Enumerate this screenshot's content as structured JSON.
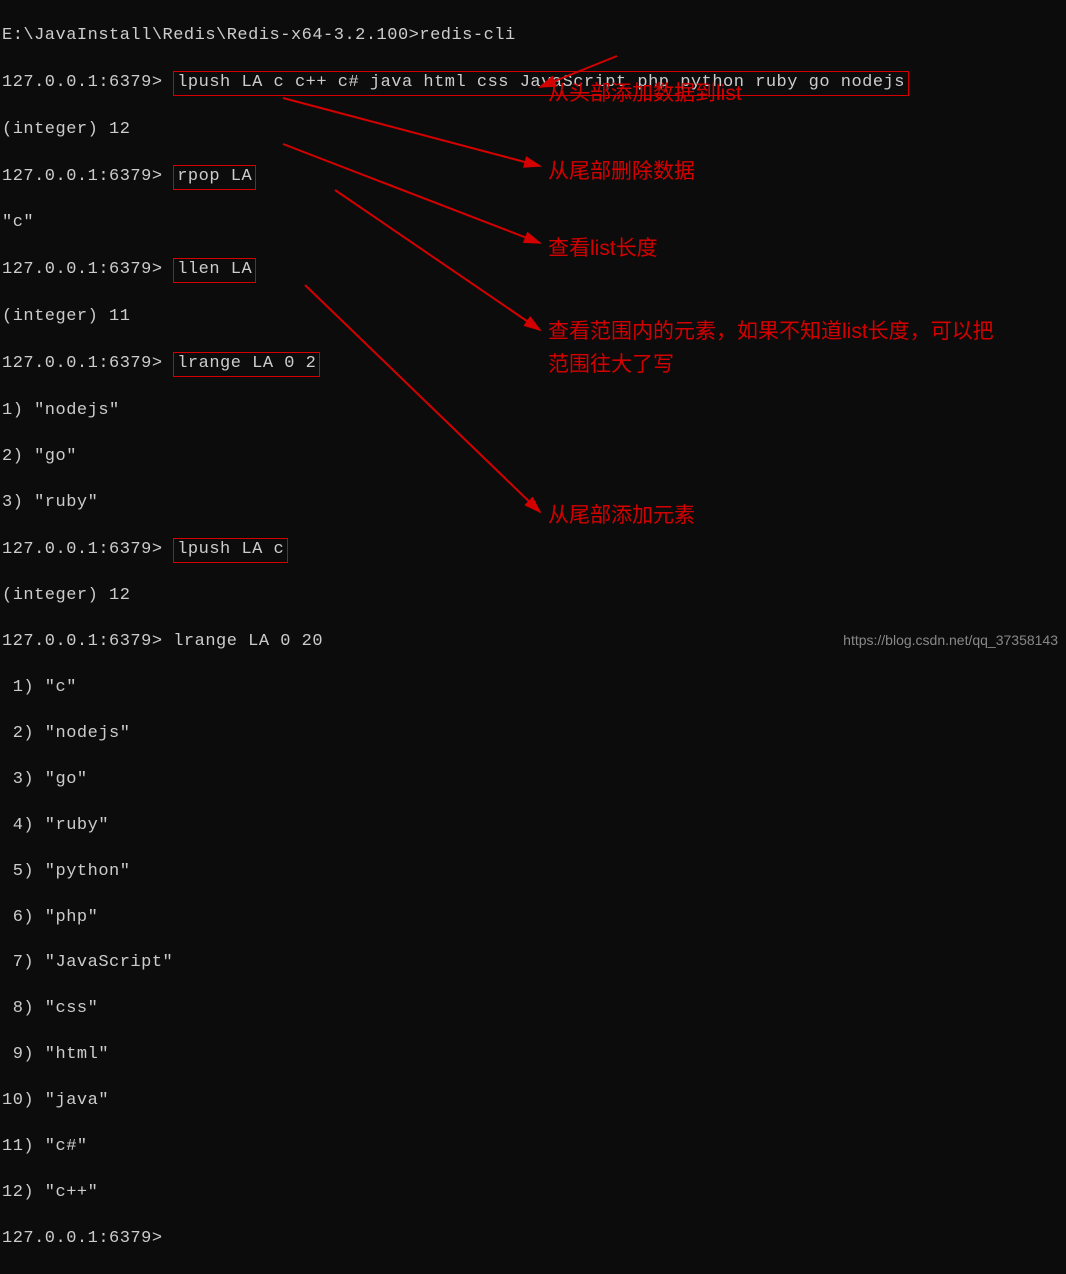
{
  "path_line": "E:\\JavaInstall\\Redis\\Redis-x64-3.2.100>redis-cli",
  "prompt": "127.0.0.1:6379> ",
  "cmds": {
    "lpush1": "lpush LA c c++ c# java html css JavaScript php python ruby go nodejs",
    "rpop": "rpop LA",
    "llen": "llen LA",
    "lrange1": "lrange LA 0 2",
    "lpush2": "lpush LA c",
    "lrange2": "lrange LA 0 20"
  },
  "outputs": {
    "int12": "(integer) 12",
    "c": "\"c\"",
    "int11": "(integer) 11",
    "r1": "1) \"nodejs\"",
    "r2": "2) \"go\"",
    "r3": "3) \"ruby\"",
    "f1": " 1) \"c\"",
    "f2": " 2) \"nodejs\"",
    "f3": " 3) \"go\"",
    "f4": " 4) \"ruby\"",
    "f5": " 5) \"python\"",
    "f6": " 6) \"php\"",
    "f7": " 7) \"JavaScript\"",
    "f8": " 8) \"css\"",
    "f9": " 9) \"html\"",
    "f10": "10) \"java\"",
    "f11": "11) \"c#\"",
    "f12": "12) \"c++\""
  },
  "annotations": {
    "a1": "从头部添加数据到list",
    "a2": "从尾部删除数据",
    "a3": "查看list长度",
    "a4": "查看范围内的元素，如果不知道list长度，可以把范围往大了写",
    "a5": "从尾部添加元素"
  },
  "watermark": "https://blog.csdn.net/qq_37358143"
}
